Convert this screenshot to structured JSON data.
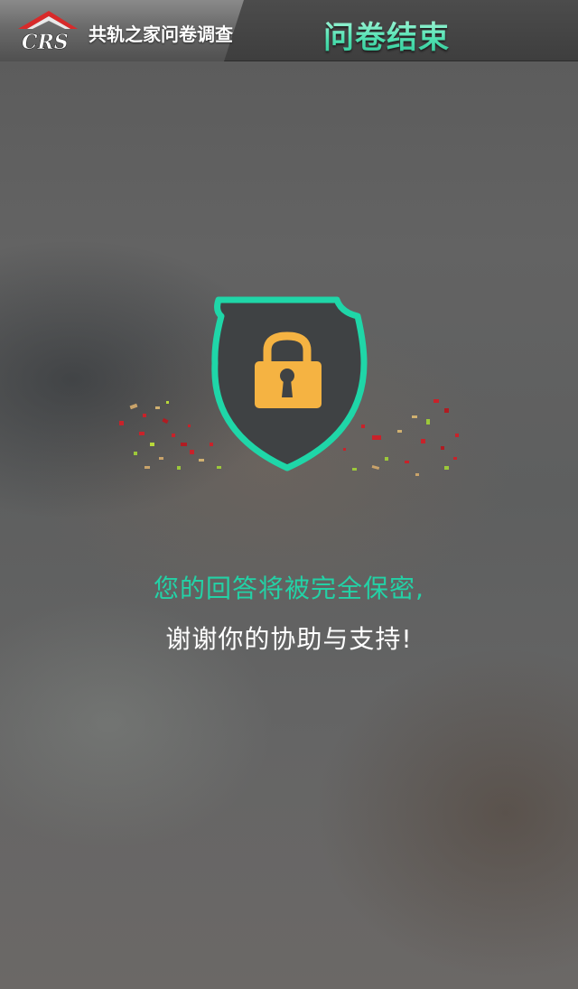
{
  "header": {
    "logo_text": "CRS",
    "app_name": "共轨之家问卷调查",
    "page_title": "问卷结束"
  },
  "main": {
    "icon": "shield-lock-icon",
    "message_primary": "您的回答将被完全保密,",
    "message_secondary": "谢谢你的协助与支持!"
  },
  "colors": {
    "accent": "#1fd6a8",
    "lock": "#f5b342",
    "logo_red": "#d82a2a"
  }
}
